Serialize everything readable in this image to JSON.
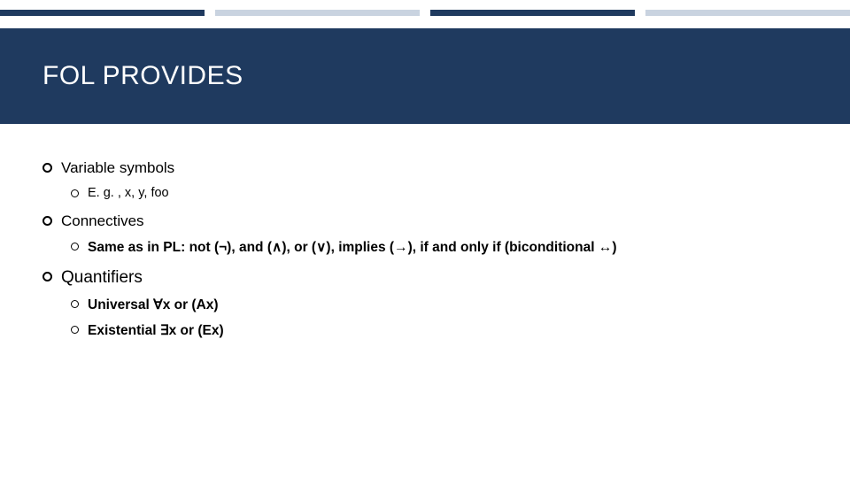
{
  "title": "FOL PROVIDES",
  "items": [
    {
      "label": "Variable symbols",
      "class": "lbl-lg",
      "children": [
        {
          "label": "E. g. , x, y, foo",
          "class": "lbl-sm"
        }
      ]
    },
    {
      "label": "Connectives",
      "class": "lbl-lg",
      "children": [
        {
          "label": "Same as in PL: not (¬), and (∧), or (∨), implies (→), if and only if (biconditional ↔)",
          "class": "lbl-md bold"
        }
      ]
    },
    {
      "label": "Quantifiers",
      "class": "lbl-xl",
      "children": [
        {
          "label": "Universal ∀x or  (Ax)",
          "class": "lbl-md bold"
        },
        {
          "label": "Existential ∃x or (Ex)",
          "class": "lbl-md bold"
        }
      ]
    }
  ]
}
